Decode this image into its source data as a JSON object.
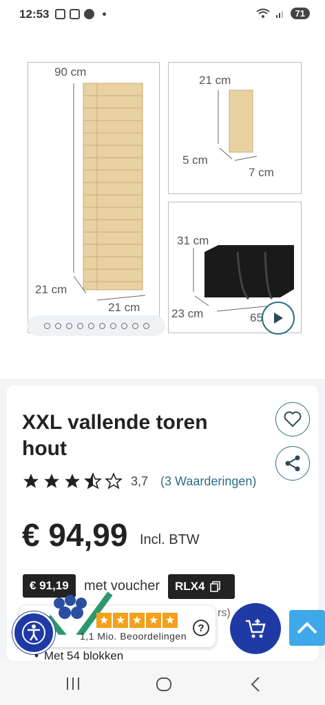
{
  "status": {
    "time": "12:53",
    "battery": "71"
  },
  "gallery": {
    "tower_height": "90 cm",
    "tower_depth": "21 cm",
    "tower_width": "21 cm",
    "block_height": "21 cm",
    "block_depth": "5 cm",
    "block_width": "7 cm",
    "bag_height": "31 cm",
    "bag_depth": "23 cm",
    "bag_width": "65",
    "dot_count": 10
  },
  "product": {
    "title": "XXL vallende toren hout",
    "rating_value": "3,7",
    "rating_count": "(3 Waarderingen)",
    "rating_stars": 3.5,
    "price": "€ 94,99",
    "price_note": "Incl. BTW",
    "voucher_price": "€ 91,19",
    "voucher_text": "met voucher",
    "voucher_code": "RLX4",
    "bullet": "Met 54 blokken"
  },
  "review_widget": {
    "text": "1,1 Mio. Beoordelingen",
    "help": "?",
    "partial_text": "rs)"
  },
  "colors": {
    "accent": "#2a6d88",
    "brand_blue": "#1f3aa5",
    "scroll_top": "#3ea8e8",
    "star": "#f4a01c"
  }
}
